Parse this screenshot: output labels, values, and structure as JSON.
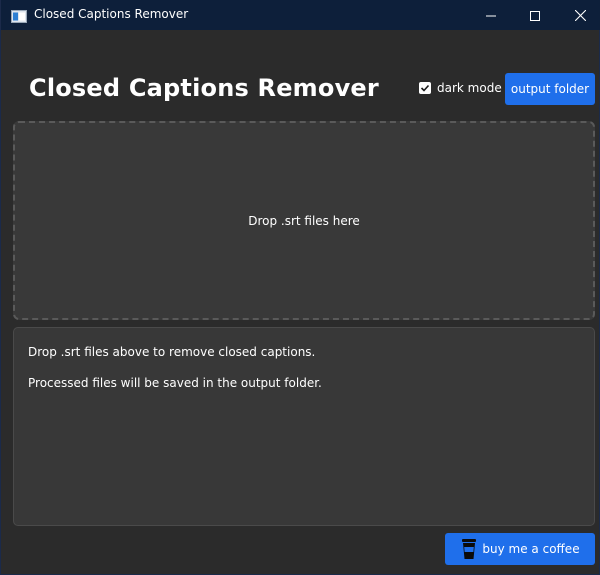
{
  "window": {
    "title": "Closed Captions Remover",
    "controls": {
      "minimize": "minimize-icon",
      "maximize": "maximize-icon",
      "close": "close-icon"
    }
  },
  "header": {
    "title": "Closed Captions Remover",
    "dark_mode": {
      "label": "dark mode",
      "checked": true
    },
    "output_folder_label": "output folder"
  },
  "dropzone": {
    "text": "Drop .srt files here"
  },
  "log": {
    "lines": [
      "Drop .srt files above to remove closed captions.",
      "Processed files will be saved in the output folder."
    ]
  },
  "footer": {
    "coffee_label": "buy me a coffee",
    "coffee_icon": "coffee-cup-icon"
  },
  "colors": {
    "titlebar": "#0d1f3a",
    "background": "#2b2b2b",
    "panel": "#393939",
    "accent": "#1f6feb",
    "text": "#ffffff"
  }
}
